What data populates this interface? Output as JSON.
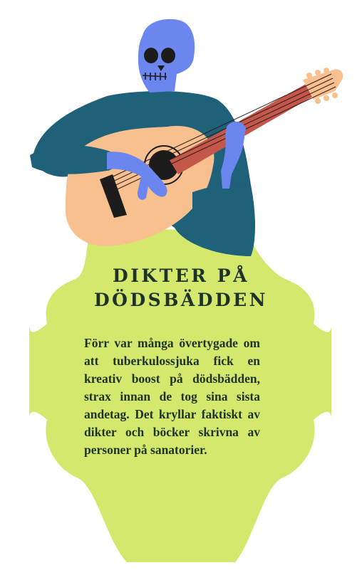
{
  "title": {
    "line1": "DIKTER PÅ",
    "line2": "DÖDSBÄDDEN"
  },
  "body": "Förr var många övertygade om att tuberkulossjuka fick en kreativ boost på dödsbädden, strax innan de tog sina sista andetag. Det kryllar faktiskt av dikter och böcker skrivna av personer på sanatorier.",
  "colors": {
    "badge": "#d4e86e",
    "skull": "#6b86ee",
    "sweater": "#1f6178",
    "guitar_body": "#f7c08e",
    "guitar_neck": "#c3574a",
    "text": "#1c3326"
  },
  "icons": [
    "skeleton-icon",
    "skull-icon",
    "guitar-icon"
  ]
}
